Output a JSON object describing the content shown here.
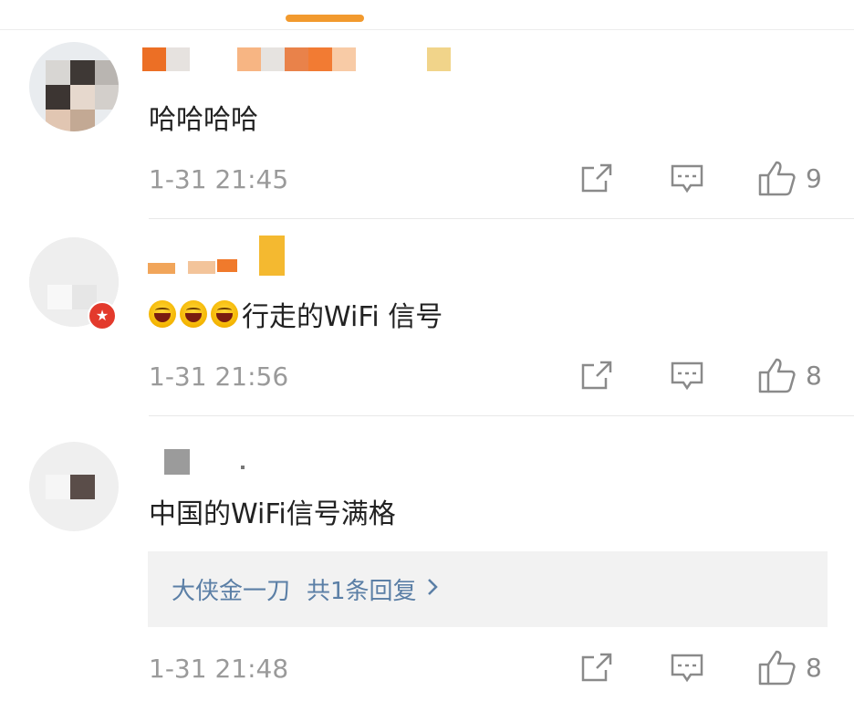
{
  "comments": [
    {
      "text": "哈哈哈哈",
      "time": "1-31 21:45",
      "likes": "9"
    },
    {
      "text": "行走的WiFi 信号",
      "time": "1-31 21:56",
      "likes": "8",
      "badge_icon": "star-badge-icon"
    },
    {
      "text": "中国的WiFi信号满格",
      "time": "1-31 21:48",
      "likes": "8",
      "reply": {
        "user": "大侠金一刀",
        "count": "共1条回复"
      }
    }
  ],
  "colors": {
    "accent": "#f29a2e",
    "reply_link": "#5b7fa6",
    "meta": "#9a9a9a"
  }
}
